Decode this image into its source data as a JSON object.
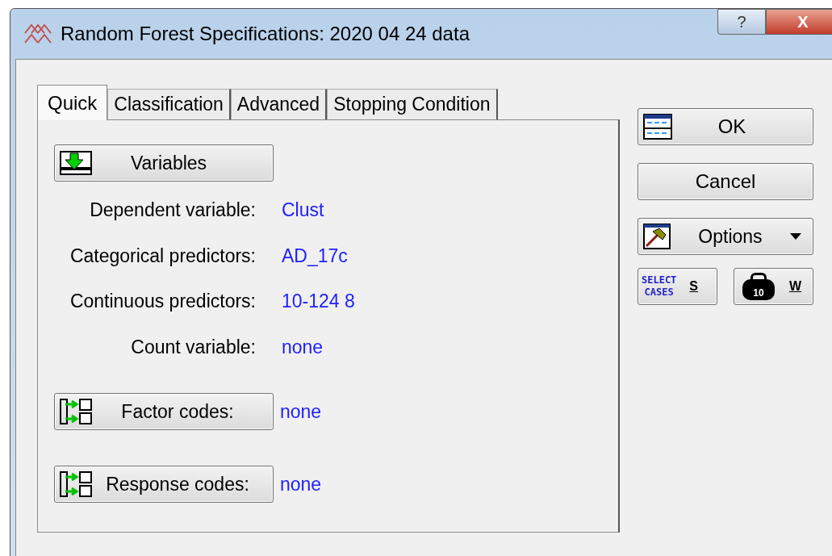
{
  "window": {
    "title": "Random Forest Specifications: 2020 04 24 data",
    "help": "?",
    "close": "X"
  },
  "tabs": [
    {
      "label": "Quick",
      "selected": true
    },
    {
      "label": "Classification",
      "selected": false
    },
    {
      "label": "Advanced",
      "selected": false
    },
    {
      "label": "Stopping Condition",
      "selected": false
    }
  ],
  "variables_button": "Variables",
  "fields": [
    {
      "label": "Dependent variable:",
      "value": "Clust"
    },
    {
      "label": "Categorical predictors:",
      "value": "AD_17c"
    },
    {
      "label": "Continuous predictors:",
      "value": "10-124 8"
    },
    {
      "label": "Count variable:",
      "value": "none"
    }
  ],
  "code_buttons": [
    {
      "label": "Factor codes:",
      "value": "none"
    },
    {
      "label": "Response codes:",
      "value": "none"
    }
  ],
  "side_buttons": {
    "ok": "OK",
    "cancel": "Cancel",
    "options": "Options",
    "select_cases_icon": [
      "SELECT",
      "CASES"
    ],
    "select_cases": "S",
    "weight": "W",
    "weight_icon": "10"
  }
}
